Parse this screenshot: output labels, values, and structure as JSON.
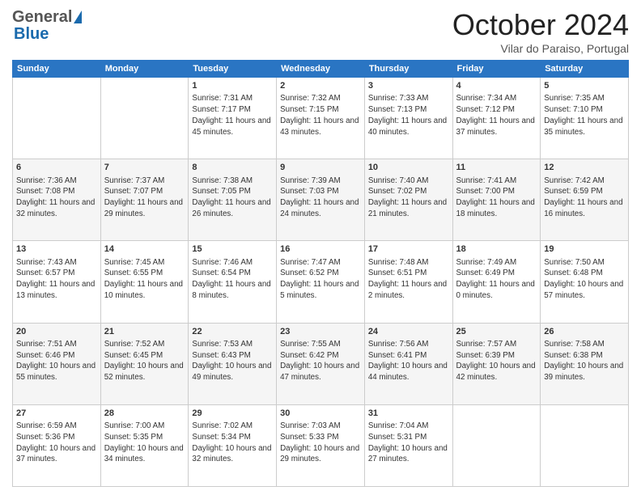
{
  "header": {
    "logo": {
      "general": "General",
      "blue": "Blue"
    },
    "title": "October 2024",
    "location": "Vilar do Paraiso, Portugal"
  },
  "weekdays": [
    "Sunday",
    "Monday",
    "Tuesday",
    "Wednesday",
    "Thursday",
    "Friday",
    "Saturday"
  ],
  "weeks": [
    [
      {
        "day": "",
        "sunrise": "",
        "sunset": "",
        "daylight": ""
      },
      {
        "day": "",
        "sunrise": "",
        "sunset": "",
        "daylight": ""
      },
      {
        "day": "1",
        "sunrise": "Sunrise: 7:31 AM",
        "sunset": "Sunset: 7:17 PM",
        "daylight": "Daylight: 11 hours and 45 minutes."
      },
      {
        "day": "2",
        "sunrise": "Sunrise: 7:32 AM",
        "sunset": "Sunset: 7:15 PM",
        "daylight": "Daylight: 11 hours and 43 minutes."
      },
      {
        "day": "3",
        "sunrise": "Sunrise: 7:33 AM",
        "sunset": "Sunset: 7:13 PM",
        "daylight": "Daylight: 11 hours and 40 minutes."
      },
      {
        "day": "4",
        "sunrise": "Sunrise: 7:34 AM",
        "sunset": "Sunset: 7:12 PM",
        "daylight": "Daylight: 11 hours and 37 minutes."
      },
      {
        "day": "5",
        "sunrise": "Sunrise: 7:35 AM",
        "sunset": "Sunset: 7:10 PM",
        "daylight": "Daylight: 11 hours and 35 minutes."
      }
    ],
    [
      {
        "day": "6",
        "sunrise": "Sunrise: 7:36 AM",
        "sunset": "Sunset: 7:08 PM",
        "daylight": "Daylight: 11 hours and 32 minutes."
      },
      {
        "day": "7",
        "sunrise": "Sunrise: 7:37 AM",
        "sunset": "Sunset: 7:07 PM",
        "daylight": "Daylight: 11 hours and 29 minutes."
      },
      {
        "day": "8",
        "sunrise": "Sunrise: 7:38 AM",
        "sunset": "Sunset: 7:05 PM",
        "daylight": "Daylight: 11 hours and 26 minutes."
      },
      {
        "day": "9",
        "sunrise": "Sunrise: 7:39 AM",
        "sunset": "Sunset: 7:03 PM",
        "daylight": "Daylight: 11 hours and 24 minutes."
      },
      {
        "day": "10",
        "sunrise": "Sunrise: 7:40 AM",
        "sunset": "Sunset: 7:02 PM",
        "daylight": "Daylight: 11 hours and 21 minutes."
      },
      {
        "day": "11",
        "sunrise": "Sunrise: 7:41 AM",
        "sunset": "Sunset: 7:00 PM",
        "daylight": "Daylight: 11 hours and 18 minutes."
      },
      {
        "day": "12",
        "sunrise": "Sunrise: 7:42 AM",
        "sunset": "Sunset: 6:59 PM",
        "daylight": "Daylight: 11 hours and 16 minutes."
      }
    ],
    [
      {
        "day": "13",
        "sunrise": "Sunrise: 7:43 AM",
        "sunset": "Sunset: 6:57 PM",
        "daylight": "Daylight: 11 hours and 13 minutes."
      },
      {
        "day": "14",
        "sunrise": "Sunrise: 7:45 AM",
        "sunset": "Sunset: 6:55 PM",
        "daylight": "Daylight: 11 hours and 10 minutes."
      },
      {
        "day": "15",
        "sunrise": "Sunrise: 7:46 AM",
        "sunset": "Sunset: 6:54 PM",
        "daylight": "Daylight: 11 hours and 8 minutes."
      },
      {
        "day": "16",
        "sunrise": "Sunrise: 7:47 AM",
        "sunset": "Sunset: 6:52 PM",
        "daylight": "Daylight: 11 hours and 5 minutes."
      },
      {
        "day": "17",
        "sunrise": "Sunrise: 7:48 AM",
        "sunset": "Sunset: 6:51 PM",
        "daylight": "Daylight: 11 hours and 2 minutes."
      },
      {
        "day": "18",
        "sunrise": "Sunrise: 7:49 AM",
        "sunset": "Sunset: 6:49 PM",
        "daylight": "Daylight: 11 hours and 0 minutes."
      },
      {
        "day": "19",
        "sunrise": "Sunrise: 7:50 AM",
        "sunset": "Sunset: 6:48 PM",
        "daylight": "Daylight: 10 hours and 57 minutes."
      }
    ],
    [
      {
        "day": "20",
        "sunrise": "Sunrise: 7:51 AM",
        "sunset": "Sunset: 6:46 PM",
        "daylight": "Daylight: 10 hours and 55 minutes."
      },
      {
        "day": "21",
        "sunrise": "Sunrise: 7:52 AM",
        "sunset": "Sunset: 6:45 PM",
        "daylight": "Daylight: 10 hours and 52 minutes."
      },
      {
        "day": "22",
        "sunrise": "Sunrise: 7:53 AM",
        "sunset": "Sunset: 6:43 PM",
        "daylight": "Daylight: 10 hours and 49 minutes."
      },
      {
        "day": "23",
        "sunrise": "Sunrise: 7:55 AM",
        "sunset": "Sunset: 6:42 PM",
        "daylight": "Daylight: 10 hours and 47 minutes."
      },
      {
        "day": "24",
        "sunrise": "Sunrise: 7:56 AM",
        "sunset": "Sunset: 6:41 PM",
        "daylight": "Daylight: 10 hours and 44 minutes."
      },
      {
        "day": "25",
        "sunrise": "Sunrise: 7:57 AM",
        "sunset": "Sunset: 6:39 PM",
        "daylight": "Daylight: 10 hours and 42 minutes."
      },
      {
        "day": "26",
        "sunrise": "Sunrise: 7:58 AM",
        "sunset": "Sunset: 6:38 PM",
        "daylight": "Daylight: 10 hours and 39 minutes."
      }
    ],
    [
      {
        "day": "27",
        "sunrise": "Sunrise: 6:59 AM",
        "sunset": "Sunset: 5:36 PM",
        "daylight": "Daylight: 10 hours and 37 minutes."
      },
      {
        "day": "28",
        "sunrise": "Sunrise: 7:00 AM",
        "sunset": "Sunset: 5:35 PM",
        "daylight": "Daylight: 10 hours and 34 minutes."
      },
      {
        "day": "29",
        "sunrise": "Sunrise: 7:02 AM",
        "sunset": "Sunset: 5:34 PM",
        "daylight": "Daylight: 10 hours and 32 minutes."
      },
      {
        "day": "30",
        "sunrise": "Sunrise: 7:03 AM",
        "sunset": "Sunset: 5:33 PM",
        "daylight": "Daylight: 10 hours and 29 minutes."
      },
      {
        "day": "31",
        "sunrise": "Sunrise: 7:04 AM",
        "sunset": "Sunset: 5:31 PM",
        "daylight": "Daylight: 10 hours and 27 minutes."
      },
      {
        "day": "",
        "sunrise": "",
        "sunset": "",
        "daylight": ""
      },
      {
        "day": "",
        "sunrise": "",
        "sunset": "",
        "daylight": ""
      }
    ]
  ]
}
